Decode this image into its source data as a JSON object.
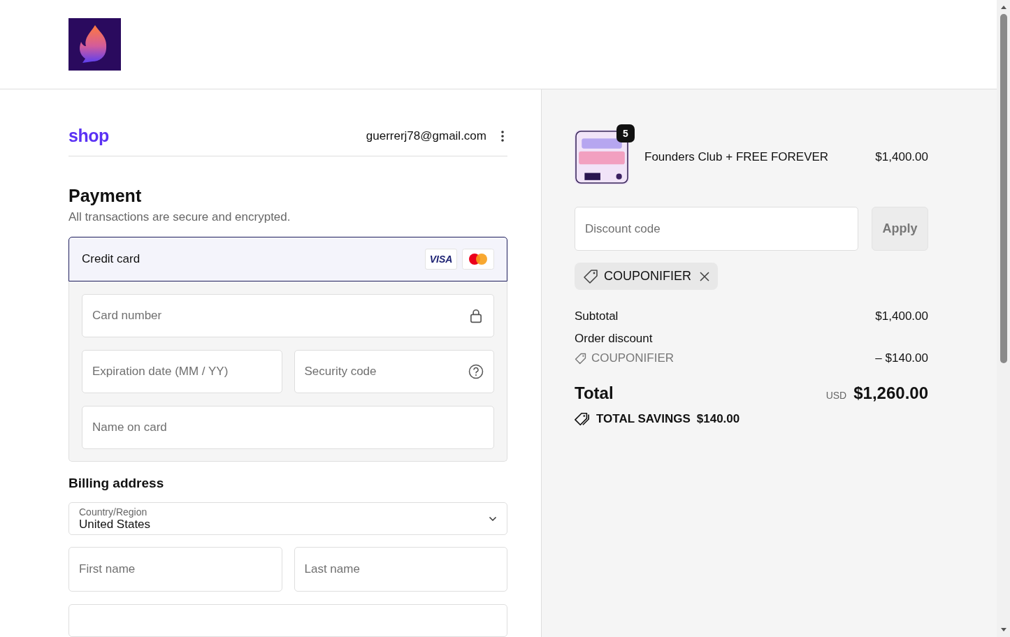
{
  "account": {
    "brand": "shop",
    "email": "guerrerj78@gmail.com"
  },
  "payment": {
    "title": "Payment",
    "subtitle": "All transactions are secure and encrypted.",
    "methods": [
      {
        "label": "Credit card",
        "selected": true,
        "card_badge": "VISA"
      }
    ],
    "fields": {
      "card_number": "Card number",
      "expiration": "Expiration date (MM / YY)",
      "security_code": "Security code",
      "name_on_card": "Name on card"
    }
  },
  "billing": {
    "title": "Billing address",
    "country": {
      "label": "Country/Region",
      "value": "United States"
    },
    "first_name": "First name",
    "last_name": "Last name"
  },
  "order": {
    "items": [
      {
        "name": "Founders Club + FREE FOREVER",
        "price": "$1,400.00",
        "quantity": "5"
      }
    ],
    "discount": {
      "placeholder": "Discount code",
      "button": "Apply"
    },
    "applied_codes": [
      "COUPONIFIER"
    ],
    "subtotal": {
      "label": "Subtotal",
      "amount": "$1,400.00"
    },
    "order_discount": {
      "label": "Order discount",
      "code": "COUPONIFIER",
      "amount": "– $140.00"
    },
    "total": {
      "label": "Total",
      "currency": "USD",
      "amount": "$1,260.00"
    },
    "savings": {
      "label": "TOTAL SAVINGS",
      "amount": "$140.00"
    }
  }
}
